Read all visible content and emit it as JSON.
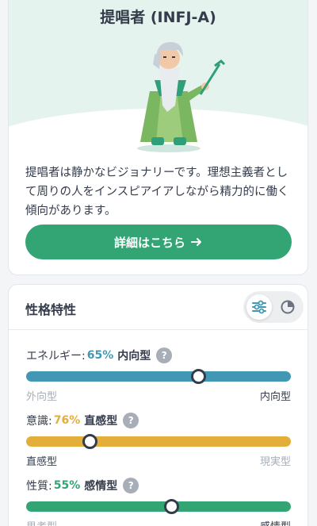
{
  "profile": {
    "type_title": "提唱者 (INFJ-A)",
    "description": "提唱者は静かなビジョナリーです。理想主義者として周りの人をインスピアイアしながら精力的に働く傾向があります。",
    "cta_label": "詳細はこちら",
    "cta_icon": "arrow-right-icon",
    "avatar": "elderly-sage-with-staff-illustration"
  },
  "traits": {
    "title": "性格特性",
    "view_options": [
      "sliders-icon",
      "pie-chart-icon"
    ],
    "active_view": "sliders-icon",
    "help_glyph": "?",
    "items": [
      {
        "label": "エネルギー:",
        "percent": "65%",
        "side": "内向型",
        "left_pole": "外向型",
        "right_pole": "内向型",
        "value": 65,
        "knob_position_percent": 65,
        "active_pole": "right",
        "color": "#4298b4"
      },
      {
        "label": "意識:",
        "percent": "76%",
        "side": "直感型",
        "left_pole": "直感型",
        "right_pole": "現実型",
        "value": 76,
        "knob_position_percent": 24,
        "active_pole": "left",
        "color": "#e4ae3a"
      },
      {
        "label": "性質:",
        "percent": "55%",
        "side": "感情型",
        "left_pole": "思考型",
        "right_pole": "感情型",
        "value": 55,
        "knob_position_percent": 55,
        "active_pole": "right",
        "color": "#33a474"
      }
    ]
  }
}
